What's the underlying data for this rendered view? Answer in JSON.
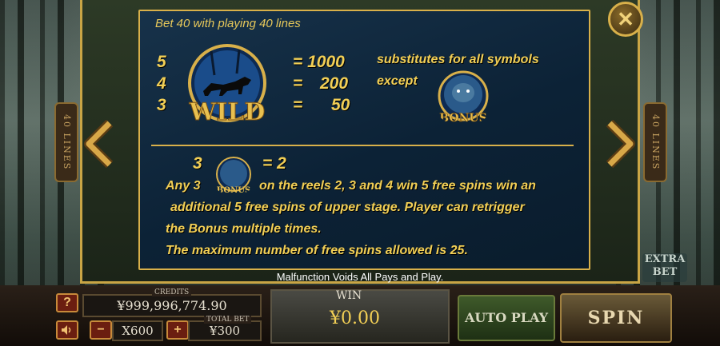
{
  "paytable": {
    "bet_line": "Bet 40 with playing 40 lines",
    "wild": {
      "label": "WILD",
      "counts": [
        "5",
        "4",
        "3"
      ],
      "equals": [
        "= 1000",
        "=",
        "="
      ],
      "payouts": [
        "",
        "200",
        "50"
      ],
      "desc_line1": "substitutes for all symbols",
      "desc_line2": "except"
    },
    "bonus": {
      "label": "BONUS",
      "count": "3",
      "payout": "= 2",
      "para_prefix": "Any 3",
      "para_line1_rest": "on the reels 2, 3 and 4 win 5 free spins win an",
      "para_line2": "additional 5 free spins of upper stage. Player can retrigger",
      "para_line3": "the Bonus multiple times.",
      "para_line4": "The maximum number of free spins allowed is 25."
    }
  },
  "disclaimer": "Malfunction Voids All Pays and Play.",
  "lines_tab": "40 LINES",
  "extra_bet_label": "EXTRA BET",
  "close_symbol": "✕",
  "bottom_bar": {
    "help_label": "?",
    "sound_icon": "speaker-icon",
    "credits_label": "CREDITS",
    "credits_value": "¥999,996,774.90",
    "minus_label": "−",
    "plus_label": "+",
    "bet_multiplier": "X600",
    "total_bet_label": "TOTAL BET",
    "total_bet_value": "¥300",
    "win_label": "WIN",
    "win_value": "¥0.00",
    "auto_play_label": "AUTO PLAY",
    "spin_label": "SPIN"
  },
  "colors": {
    "gold": "#f2cf55",
    "panel_blue": "#0c2236",
    "frame_gold": "#d8b04a"
  }
}
